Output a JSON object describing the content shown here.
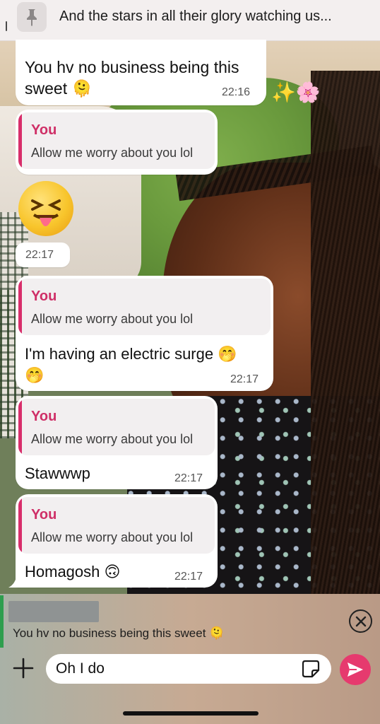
{
  "pinned": {
    "text": "And the stars in all their glory watching us..."
  },
  "messages": [
    {
      "text_line1": "You hv no business being this",
      "text_line2": "sweet 🫠",
      "time": "22:16",
      "decor": "✨🌸"
    },
    {
      "quote_author": "You",
      "quote_text": "Allow me worry about you lol"
    },
    {
      "emoji": "😝",
      "time": "22:17"
    },
    {
      "quote_author": "You",
      "quote_text": "Allow me worry about you lol",
      "text_line1": "I'm having an electric surge 🤭",
      "text_line2": "🤭",
      "time": "22:17"
    },
    {
      "quote_author": "You",
      "quote_text": "Allow me worry about you lol",
      "text": "Stawwwp",
      "time": "22:17"
    },
    {
      "quote_author": "You",
      "quote_text": "Allow me worry about you lol",
      "text": "Homagosh 🙃",
      "time": "22:17"
    }
  ],
  "reply": {
    "text": "You hv no business being this sweet 🫠"
  },
  "composer": {
    "value": "Oh I do"
  },
  "colors": {
    "accent": "#e63a6e",
    "quote_author": "#cf2f67",
    "reply_line": "#2e9e4e"
  },
  "icons": [
    "pin-icon",
    "close-icon",
    "plus-icon",
    "sticker-icon",
    "send-icon"
  ]
}
